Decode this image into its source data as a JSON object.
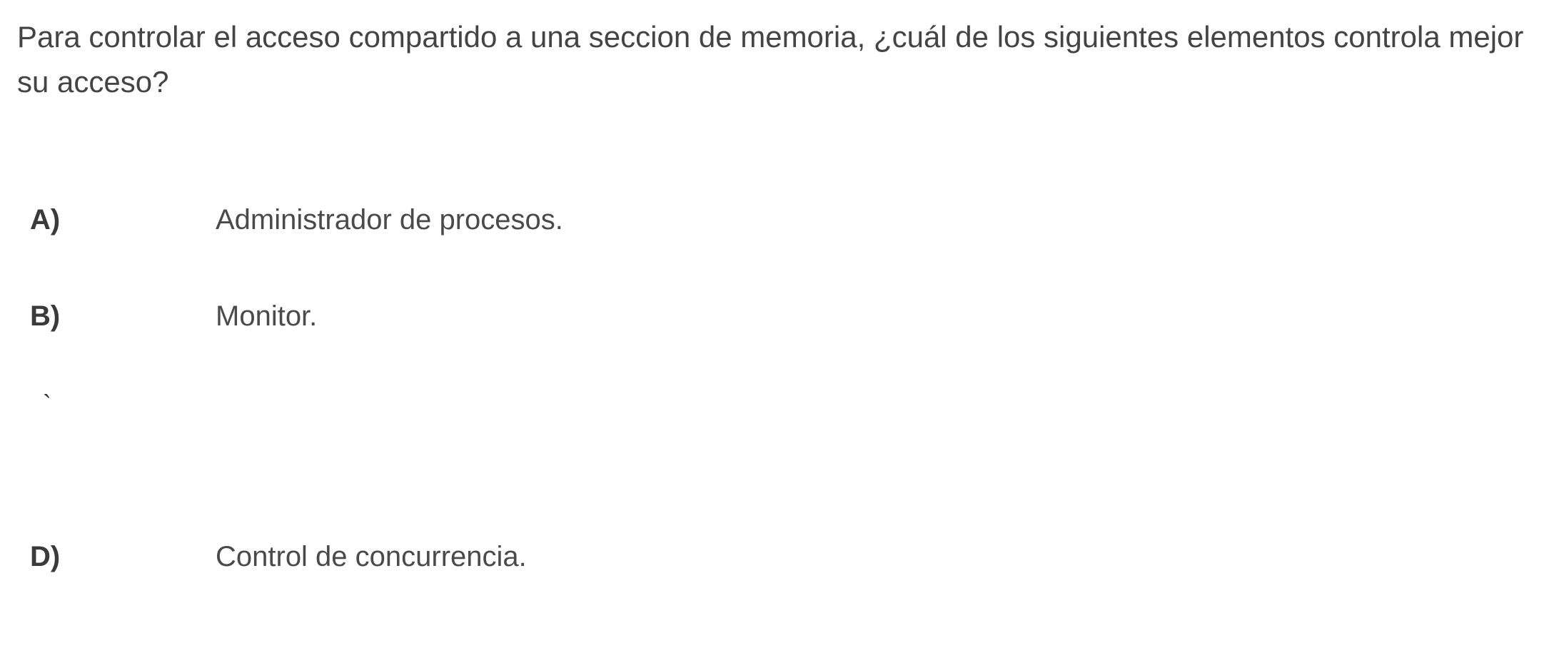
{
  "question": {
    "text": "Para controlar el acceso compartido a una seccion de memoria, ¿cuál de los siguientes elementos controla mejor su acceso?"
  },
  "options": [
    {
      "letter": "A)",
      "text": "Administrador de procesos."
    },
    {
      "letter": "B)",
      "text": "Monitor."
    },
    {
      "letter": "D)",
      "text": "Control de concurrencia."
    }
  ],
  "stray": "`"
}
